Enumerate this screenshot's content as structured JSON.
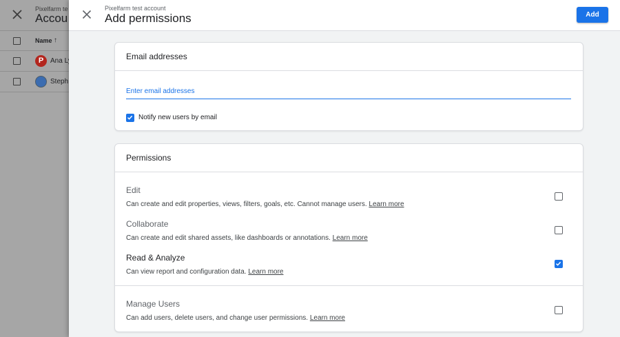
{
  "background": {
    "subtitle": "Pixelfarm te",
    "title": "Accou",
    "name_header": "Name",
    "sort_icon": "arrow-up-icon",
    "rows": [
      {
        "avatar": "P",
        "name": "Ana Ly"
      },
      {
        "avatar": "",
        "name": "Steph"
      }
    ]
  },
  "drawer": {
    "subtitle": "Pixelfarm test account",
    "title": "Add permissions",
    "add_label": "Add",
    "close_icon": "close-icon"
  },
  "email_card": {
    "title": "Email addresses",
    "placeholder": "Enter email addresses",
    "value": "",
    "notify_label": "Notify new users by email",
    "notify_checked": true
  },
  "permissions_card": {
    "title": "Permissions",
    "items": [
      {
        "title": "Edit",
        "desc": "Can create and edit properties, views, filters, goals, etc. Cannot manage users.",
        "link": "Learn more",
        "checked": false
      },
      {
        "title": "Collaborate",
        "desc": "Can create and edit shared assets, like dashboards or annotations.",
        "link": "Learn more",
        "checked": false
      },
      {
        "title": "Read & Analyze",
        "desc": "Can view report and configuration data.",
        "link": "Learn more",
        "checked": true
      },
      {
        "title": "Manage Users",
        "desc": "Can add users, delete users, and change user permissions.",
        "link": "Learn more",
        "checked": false
      }
    ]
  },
  "colors": {
    "accent": "#1a73e8",
    "overlay": "#a6a6a6"
  }
}
